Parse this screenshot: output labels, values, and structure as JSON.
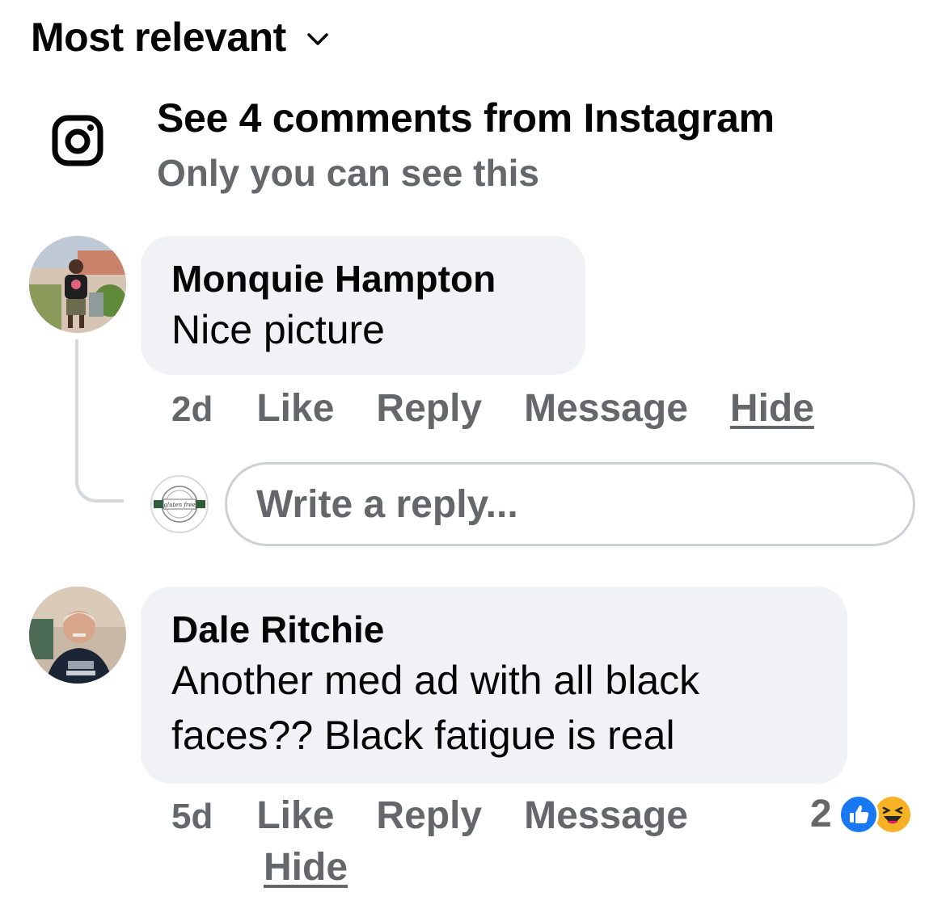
{
  "sort": {
    "label": "Most relevant"
  },
  "instagram": {
    "title": "See 4 comments from Instagram",
    "subtitle": "Only you can see this"
  },
  "comments": [
    {
      "author": "Monquie Hampton",
      "text": "Nice picture",
      "time": "2d",
      "actions": {
        "like": "Like",
        "reply": "Reply",
        "message": "Message",
        "hide": "Hide"
      }
    },
    {
      "author": "Dale Ritchie",
      "text": "Another med ad with all black faces?? Black fatigue is real",
      "time": "5d",
      "actions": {
        "like": "Like",
        "reply": "Reply",
        "message": "Message",
        "hide": "Hide"
      },
      "reactions": {
        "count": "2",
        "types": [
          "like-icon",
          "haha-icon"
        ]
      }
    }
  ],
  "reply_box": {
    "placeholder": "Write a reply...",
    "avatar_logo_text": "gluten free"
  },
  "colors": {
    "text": "#050505",
    "secondary": "#65676b",
    "bubble": "#f0f2f5",
    "like": "#1877f2",
    "haha": "#f7b125"
  }
}
